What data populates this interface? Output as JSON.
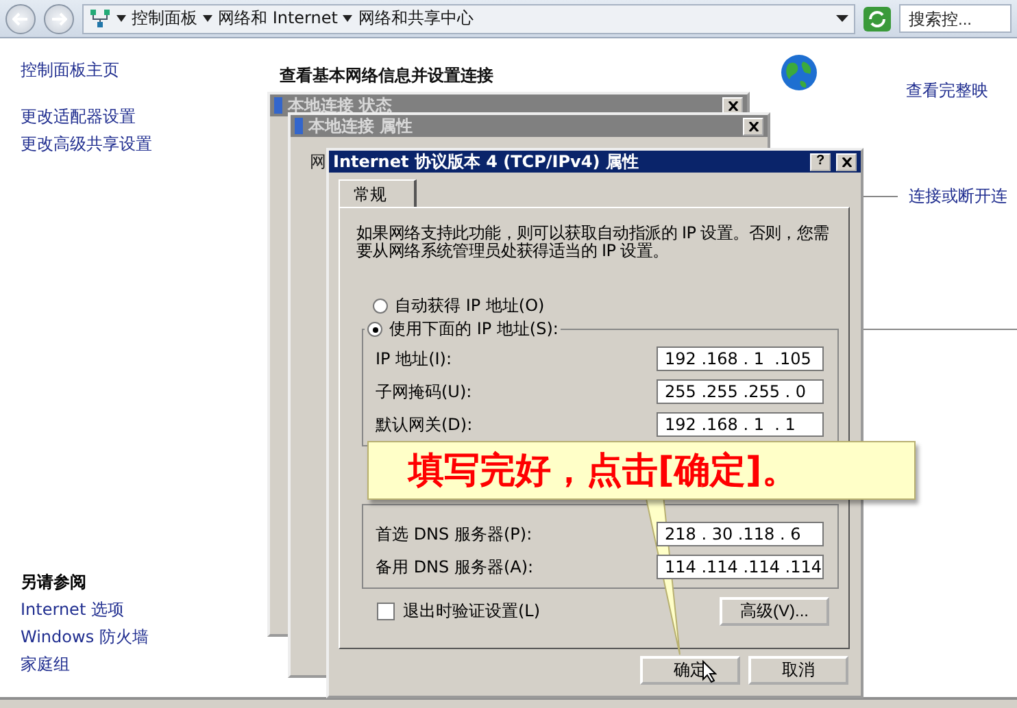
{
  "address_bar": {
    "breadcrumb": [
      "控制面板",
      "网络和 Internet",
      "网络和共享中心"
    ],
    "search": {
      "placeholder": "搜索控..."
    }
  },
  "sidebar": {
    "links": [
      "控制面板主页",
      "更改适配器设置",
      "更改高级共享设置"
    ],
    "see_also_title": "另请参阅",
    "see_also": [
      "Internet 选项",
      "Windows 防火墙",
      "家庭组"
    ]
  },
  "main": {
    "heading": "查看基本网络信息并设置连接",
    "map_link": "查看完整映",
    "connect_link": "连接或断开连"
  },
  "status_window": {
    "title": "本地连接 状态",
    "active": false
  },
  "properties_window": {
    "title": "本地连接 属性",
    "active": false,
    "tab": "网"
  },
  "ipv4_dialog": {
    "title": "Internet 协议版本 4 (TCP/IPv4) 属性",
    "active": true,
    "help_button": "?",
    "tabs": [
      {
        "label": "常规",
        "selected": true
      }
    ],
    "description": "如果网络支持此功能，则可以获取自动指派的 IP 设置。否则，您需要从网络系统管理员处获得适当的 IP 设置。",
    "radios": [
      {
        "label": "自动获得 IP 地址(O)",
        "selected": false
      },
      {
        "label": "使用下面的 IP 地址(S):",
        "selected": true
      }
    ],
    "ip_fields": [
      {
        "label": "IP 地址(I):",
        "value": "192 .168 . 1  .105"
      },
      {
        "label": "子网掩码(U):",
        "value": "255 .255 .255 . 0"
      },
      {
        "label": "默认网关(D):",
        "value": "192 .168 . 1  . 1"
      }
    ],
    "dns_fields": [
      {
        "label": "首选 DNS 服务器(P):",
        "value": "218 . 30 .118 . 6"
      },
      {
        "label": "备用 DNS 服务器(A):",
        "value": "114 .114 .114 .114"
      }
    ],
    "validate": {
      "label": "退出时验证设置(L)",
      "checked": false
    },
    "advanced_button": "高级(V)...",
    "buttons": [
      "确定",
      "取消"
    ]
  },
  "callout": {
    "text": "填写完好，点击[确定]。"
  }
}
